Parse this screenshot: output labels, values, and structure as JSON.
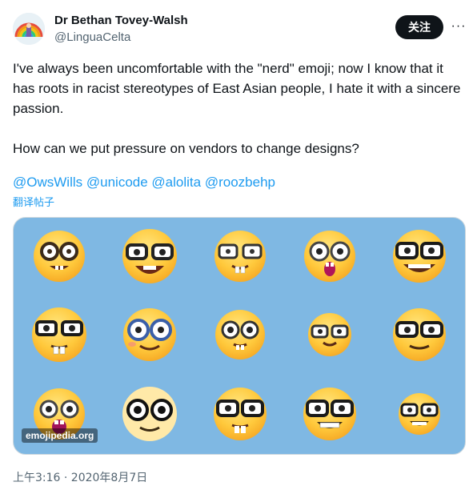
{
  "author": {
    "name": "Dr Bethan Tovey-Walsh",
    "handle": "@LinguaCelta",
    "avatar_icon": "rainbow-avatar-icon"
  },
  "actions": {
    "follow_label": "关注",
    "more_icon": "more-horizontal-icon",
    "more_label": "···"
  },
  "tweet": {
    "paragraph_1": "I've always been uncomfortable with the \"nerd\" emoji; now I know that it has roots in racist stereotypes of East Asian people, I hate it with a sincere passion.",
    "paragraph_2": "How can we put pressure on vendors to change designs?",
    "mentions": [
      "@OwsWills",
      "@unicode",
      "@alolita",
      "@roozbehp"
    ],
    "translate_label": "翻译帖子"
  },
  "media": {
    "description_icon": "nerd-face-emoji-grid",
    "watermark": "emojipedia.org",
    "background_color": "#7fb8e3"
  },
  "meta": {
    "timestamp": "上午3:16 · 2020年8月7日"
  },
  "colors": {
    "accent": "#1d9bf0",
    "text": "#0f1419",
    "secondary": "#536471"
  }
}
